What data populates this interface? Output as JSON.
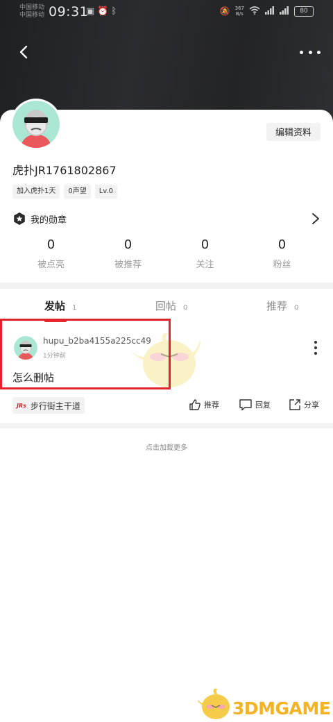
{
  "status_bar": {
    "carrier_1": "中国移动",
    "carrier_2": "中国移动",
    "time": "09:31",
    "net_speed_value": "367",
    "net_speed_unit": "B/s",
    "battery": "80"
  },
  "profile": {
    "edit_label": "编辑资料",
    "username": "虎扑JR1761802867",
    "tags": [
      "加入虎扑1天",
      "0声望",
      "Lv.0"
    ],
    "badge_label": "我的勋章",
    "stats": [
      {
        "value": "0",
        "label": "被点亮"
      },
      {
        "value": "0",
        "label": "被推荐"
      },
      {
        "value": "0",
        "label": "关注"
      },
      {
        "value": "0",
        "label": "粉丝"
      }
    ]
  },
  "tabs": [
    {
      "label": "发帖",
      "count": "1",
      "active": true
    },
    {
      "label": "回帖",
      "count": "0",
      "active": false
    },
    {
      "label": "推荐",
      "count": "0",
      "active": false
    }
  ],
  "post": {
    "author": "hupu_b2ba4155a225cc49",
    "time": "1分钟前",
    "title": "怎么删帖",
    "board_logo": "JRs",
    "board_name": "步行街主干道",
    "actions": {
      "recommend": "推荐",
      "reply": "回复",
      "share": "分享"
    }
  },
  "load_more": "点击加载更多",
  "watermark": "3DMGAME",
  "colors": {
    "accent_red": "#e42b30",
    "highlight_red": "#e3232c",
    "header_dark": "#232426",
    "watermark_yellow": "#f2b325"
  }
}
